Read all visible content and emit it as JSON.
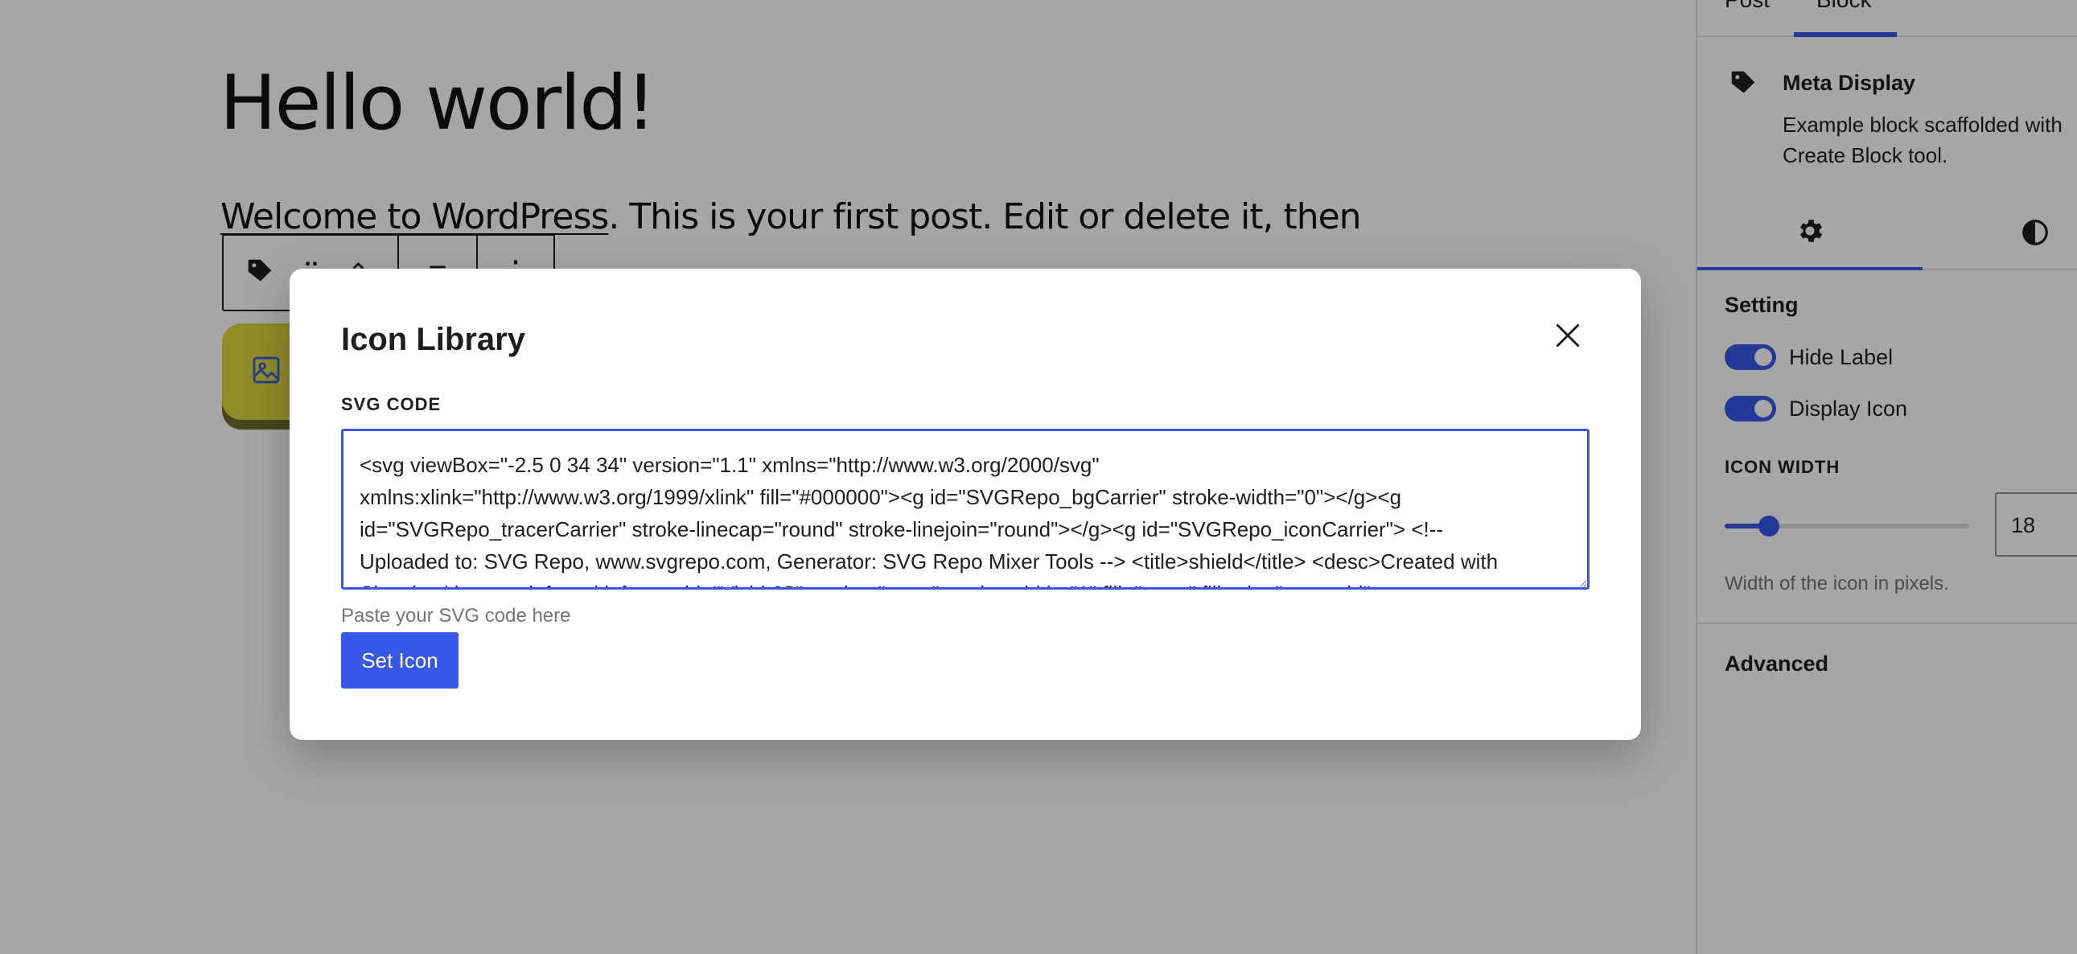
{
  "editor": {
    "post_title": "Hello world!",
    "paragraph_link": "Welcome to WordPress",
    "paragraph_rest": ". This is your first post. Edit or delete it, then",
    "toolbar": {
      "drag_handle": "⠿",
      "move_up": "⌃",
      "align": "≡",
      "more": "⋮"
    }
  },
  "sidebar": {
    "tabs": [
      {
        "label": "Post"
      },
      {
        "label": "Block"
      }
    ],
    "block_card": {
      "title": "Meta Display",
      "description": "Example block scaffolded with Create Block tool."
    },
    "setting_panel": {
      "title": "Setting",
      "toggles": [
        {
          "label": "Hide Label",
          "checked": true
        },
        {
          "label": "Display Icon",
          "checked": true
        }
      ],
      "icon_width_label": "ICON WIDTH",
      "icon_width_value": "18",
      "icon_width_slider_fraction": 0.18,
      "icon_width_help": "Width of the icon in pixels."
    },
    "advanced_panel": {
      "title": "Advanced"
    }
  },
  "modal": {
    "title": "Icon Library",
    "field_label": "SVG CODE",
    "textarea_value": "<svg viewBox=\"-2.5 0 34 34\" version=\"1.1\" xmlns=\"http://www.w3.org/2000/svg\"\nxmlns:xlink=\"http://www.w3.org/1999/xlink\" fill=\"#000000\"><g id=\"SVGRepo_bgCarrier\" stroke-width=\"0\"></g><g\nid=\"SVGRepo_tracerCarrier\" stroke-linecap=\"round\" stroke-linejoin=\"round\"></g><g id=\"SVGRepo_iconCarrier\"> <!--\nUploaded to: SVG Repo, www.svgrepo.com, Generator: SVG Repo Mixer Tools --> <title>shield</title> <desc>Created with\nSketch.</desc> <defs> </defs> <g id=\"Vivid.JS\" stroke=\"none\" stroke-width=\"1\" fill=\"none\" fill-rule=\"evenodd\"> <g",
    "help_text": "Paste your SVG code here",
    "button_label": "Set Icon"
  },
  "colors": {
    "accent": "#3858e9",
    "overlay": "rgba(0,0,0,0.35)",
    "yellow_block": "#ded93f"
  },
  "icons": [
    "tag-icon",
    "close-icon",
    "gear-icon",
    "contrast-icon",
    "image-icon"
  ]
}
